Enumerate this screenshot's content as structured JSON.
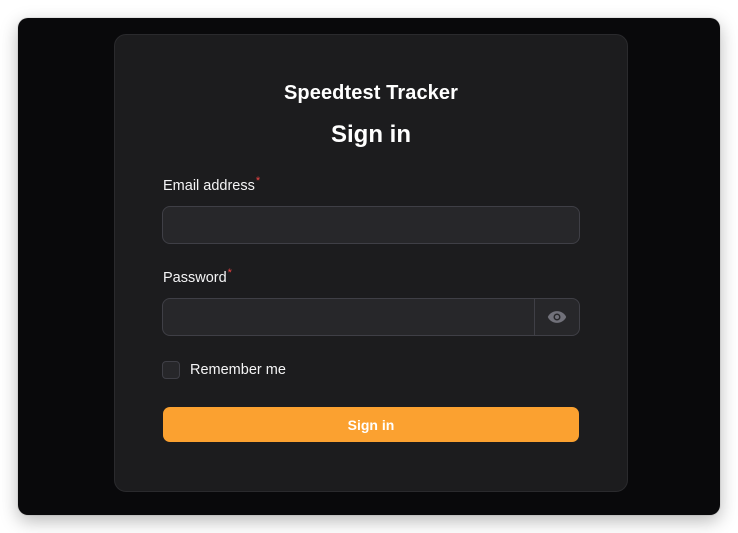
{
  "app": {
    "brand_name": "Speedtest Tracker",
    "page_heading": "Sign in"
  },
  "form": {
    "email": {
      "label": "Email address",
      "required_marker": "*",
      "value": ""
    },
    "password": {
      "label": "Password",
      "required_marker": "*",
      "value": "",
      "reveal_icon": "eye-icon"
    },
    "remember": {
      "label": "Remember me",
      "checked": false
    },
    "submit_label": "Sign in"
  },
  "colors": {
    "window_background": "#09090b",
    "card_background": "#1c1c1e",
    "input_background": "#27272a",
    "input_border": "#3f3f46",
    "primary_button": "#fba130",
    "required_marker": "#ef4444",
    "icon": "#71717a"
  }
}
